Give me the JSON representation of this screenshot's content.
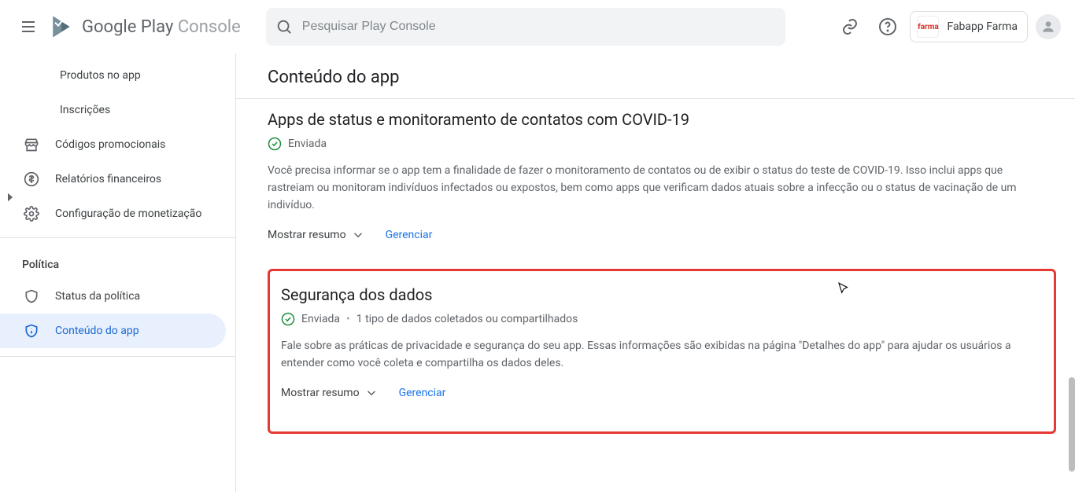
{
  "header": {
    "brand_main": "Google Play",
    "brand_sub": "Console",
    "search_placeholder": "Pesquisar Play Console",
    "developer_name": "Fabapp Farma",
    "developer_logo_text": "farma"
  },
  "sidebar": {
    "items": [
      {
        "label": "Produtos no app"
      },
      {
        "label": "Inscrições"
      },
      {
        "label": "Códigos promocionais"
      },
      {
        "label": "Relatórios financeiros"
      },
      {
        "label": "Configuração de monetização"
      }
    ],
    "policy_title": "Política",
    "policy_items": [
      {
        "label": "Status da política"
      },
      {
        "label": "Conteúdo do app"
      }
    ]
  },
  "main": {
    "page_title": "Conteúdo do app",
    "card1": {
      "title": "Apps de status e monitoramento de contatos com COVID-19",
      "status": "Enviada",
      "description": "Você precisa informar se o app tem a finalidade de fazer o monitoramento de contatos ou de exibir o status do teste de COVID-19. Isso inclui apps que rastreiam ou monitoram indivíduos infectados ou expostos, bem como apps que verificam dados atuais sobre a infecção ou o status de vacinação de um indivíduo.",
      "show_summary": "Mostrar resumo",
      "manage": "Gerenciar"
    },
    "card2": {
      "title": "Segurança dos dados",
      "status": "Enviada",
      "status_extra": "1 tipo de dados coletados ou compartilhados",
      "description": "Fale sobre as práticas de privacidade e segurança do seu app. Essas informações são exibidas na página \"Detalhes do app\" para ajudar os usuários a entender como você coleta e compartilha os dados deles.",
      "show_summary": "Mostrar resumo",
      "manage": "Gerenciar"
    }
  }
}
